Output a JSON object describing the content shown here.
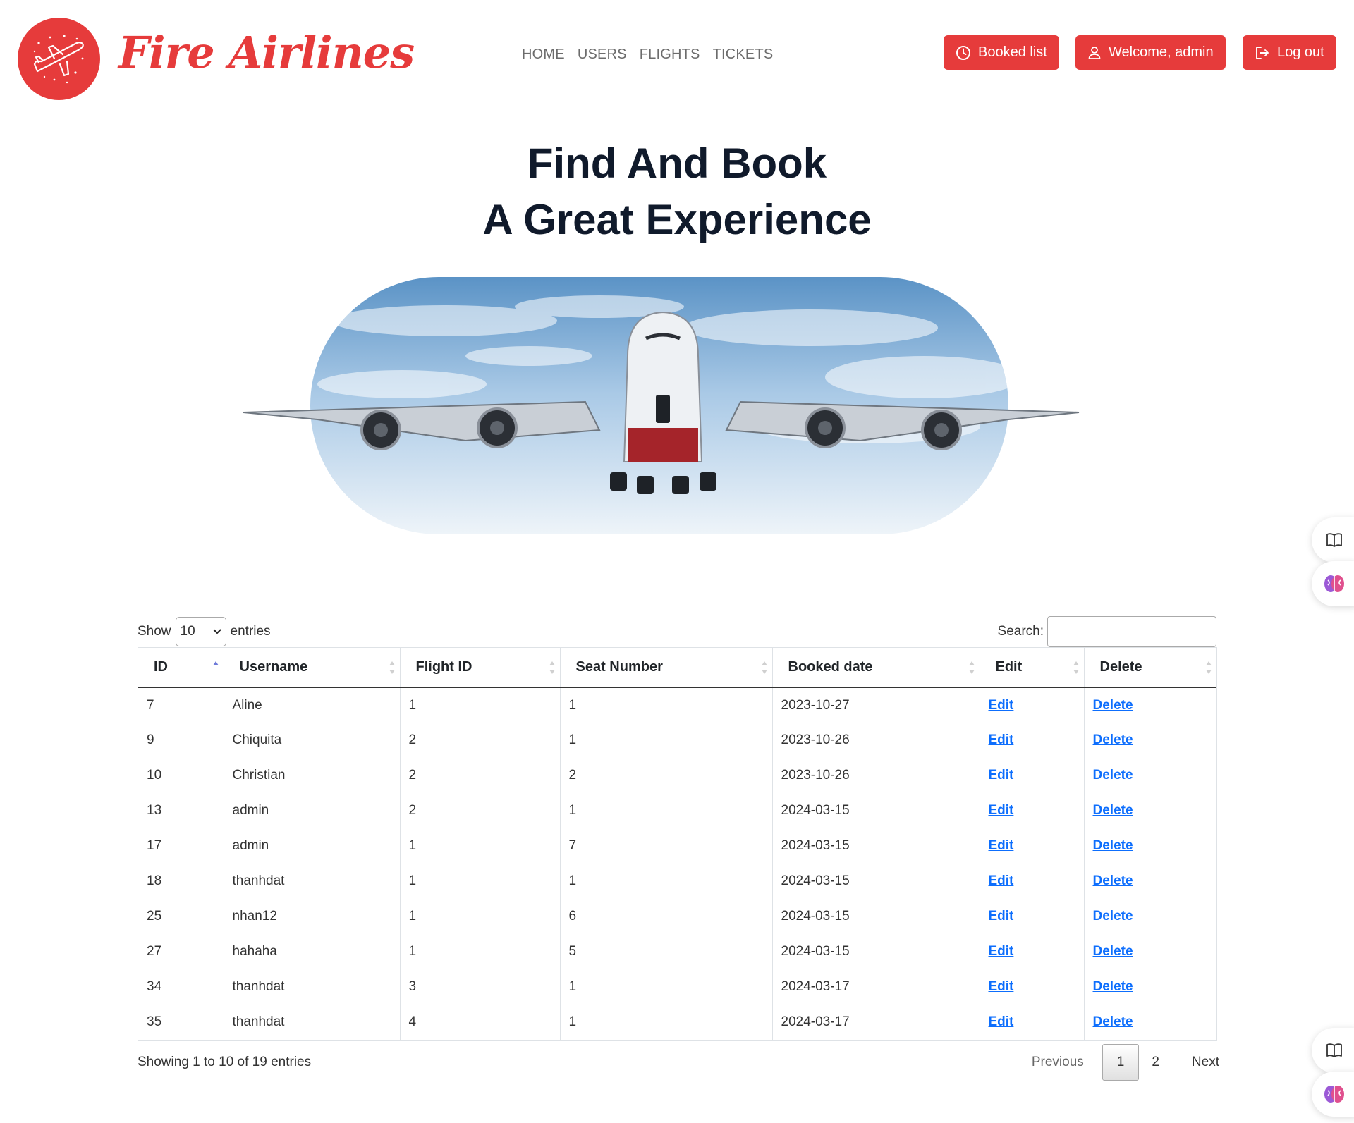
{
  "brand": {
    "name": "Fire Airlines"
  },
  "nav": {
    "items": [
      "HOME",
      "USERS",
      "FLIGHTS",
      "TICKETS"
    ]
  },
  "header_buttons": {
    "booked_list": "Booked list",
    "welcome": "Welcome, admin",
    "logout": "Log out"
  },
  "hero": {
    "line1": "Find And Book",
    "line2": "A Great Experience"
  },
  "table_controls": {
    "show_label": "Show",
    "entries_label": "entries",
    "page_length": "10",
    "search_label": "Search:",
    "search_value": ""
  },
  "table": {
    "columns": [
      "ID",
      "Username",
      "Flight ID",
      "Seat Number",
      "Booked date",
      "Edit",
      "Delete"
    ],
    "rows": [
      [
        "7",
        "Aline",
        "1",
        "1",
        "2023-10-27",
        "Edit",
        "Delete"
      ],
      [
        "9",
        "Chiquita",
        "2",
        "1",
        "2023-10-26",
        "Edit",
        "Delete"
      ],
      [
        "10",
        "Christian",
        "2",
        "2",
        "2023-10-26",
        "Edit",
        "Delete"
      ],
      [
        "13",
        "admin",
        "2",
        "1",
        "2024-03-15",
        "Edit",
        "Delete"
      ],
      [
        "17",
        "admin",
        "1",
        "7",
        "2024-03-15",
        "Edit",
        "Delete"
      ],
      [
        "18",
        "thanhdat",
        "1",
        "1",
        "2024-03-15",
        "Edit",
        "Delete"
      ],
      [
        "25",
        "nhan12",
        "1",
        "6",
        "2024-03-15",
        "Edit",
        "Delete"
      ],
      [
        "27",
        "hahaha",
        "1",
        "5",
        "2024-03-15",
        "Edit",
        "Delete"
      ],
      [
        "34",
        "thanhdat",
        "3",
        "1",
        "2024-03-17",
        "Edit",
        "Delete"
      ],
      [
        "35",
        "thanhdat",
        "4",
        "1",
        "2024-03-17",
        "Edit",
        "Delete"
      ]
    ]
  },
  "footer": {
    "info": "Showing 1 to 10 of 19 entries",
    "previous": "Previous",
    "pages": [
      "1",
      "2"
    ],
    "next": "Next"
  },
  "colors": {
    "brand_red": "#e63b3b",
    "link_blue": "#0d6efd",
    "heading_dark": "#101a2b"
  },
  "icons": {
    "logo": "airplane-icon",
    "booked_list": "clock-icon",
    "welcome": "user-icon",
    "logout": "logout-icon",
    "side_top_1": "book-icon",
    "side_top_2": "brain-icon",
    "side_bottom_1": "book-icon",
    "side_bottom_2": "brain-icon"
  }
}
